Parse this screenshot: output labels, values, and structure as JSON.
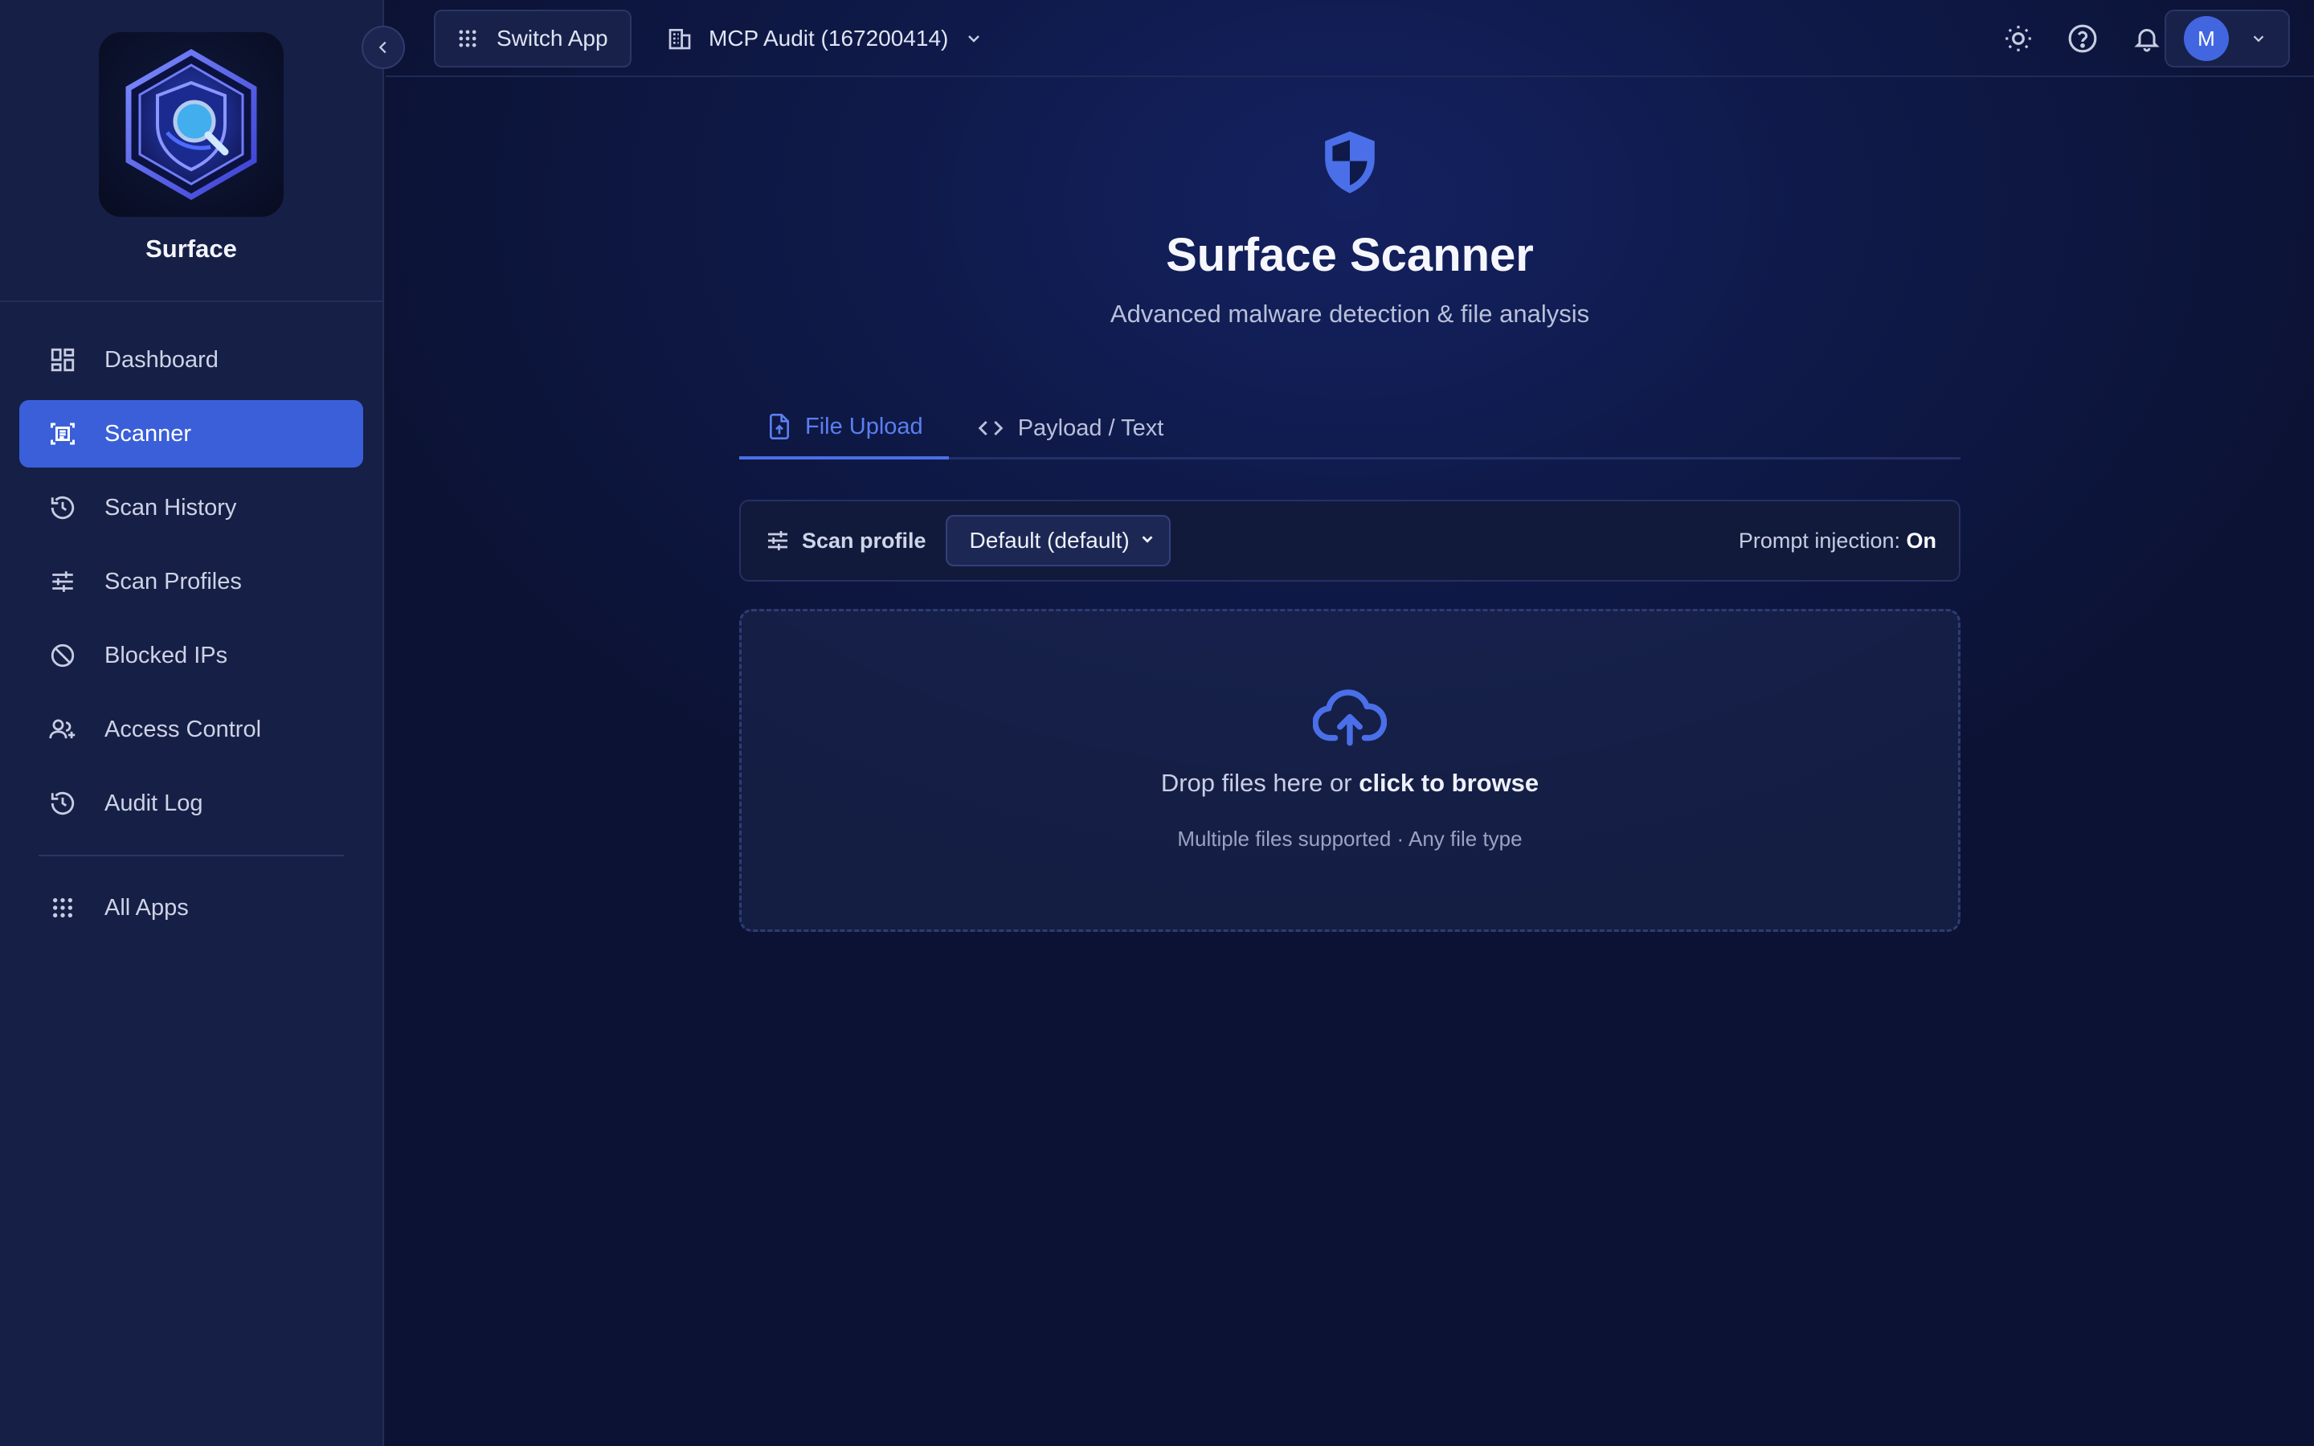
{
  "sidebar": {
    "brand": "Surface",
    "items": [
      {
        "label": "Dashboard",
        "icon": "dashboard-icon"
      },
      {
        "label": "Scanner",
        "icon": "scanner-icon",
        "active": true
      },
      {
        "label": "Scan History",
        "icon": "history-icon"
      },
      {
        "label": "Scan Profiles",
        "icon": "sliders-icon"
      },
      {
        "label": "Blocked IPs",
        "icon": "block-icon"
      },
      {
        "label": "Access Control",
        "icon": "user-plus-icon"
      },
      {
        "label": "Audit Log",
        "icon": "history-icon"
      }
    ],
    "all_apps": "All Apps"
  },
  "topbar": {
    "switch_app": "Switch App",
    "org": "MCP Audit (167200414)",
    "avatar_initial": "M"
  },
  "page": {
    "title": "Surface Scanner",
    "subtitle": "Advanced malware detection & file analysis"
  },
  "tabs": [
    {
      "label": "File Upload",
      "active": true
    },
    {
      "label": "Payload / Text"
    }
  ],
  "scan_profile": {
    "label": "Scan profile",
    "selected": "Default (default)",
    "prompt_injection_label": "Prompt injection:",
    "prompt_injection_value": "On"
  },
  "dropzone": {
    "text": "Drop files here or ",
    "link": "click to browse",
    "hint": "Multiple files supported · Any file type"
  },
  "colors": {
    "accent": "#3a5fd9",
    "sidebar_bg": "#161f45",
    "main_bg": "#0f1a4a"
  }
}
